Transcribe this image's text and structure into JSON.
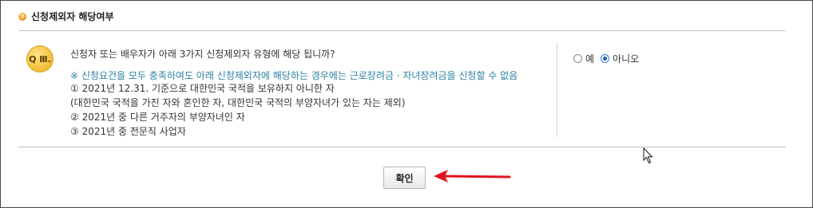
{
  "section": {
    "title": "신청제외자 해당여부"
  },
  "question": {
    "badge": "Q Ⅲ.",
    "text": "신청자 또는 배우자가 아래 3가지 신청제외자 유형에 해당 됩니까?",
    "note": "※ 신청요건을 모두 충족하여도 아래 신청제외자에 해당하는 경우에는 근로장려금 · 자녀장려금을 신청할 수 없음",
    "criteria": [
      "① 2021년 12.31. 기준으로 대한민국 국적을 보유하지 아니한 자",
      "(대한민국 국적을 가진 자와 혼인한 자, 대한민국 국적의 부양자녀가 있는 자는 제외)",
      "② 2021년 중 다른 거주자의 부양자녀인 자",
      "③ 2021년 중 전문직 사업자"
    ]
  },
  "options": [
    {
      "label": "예",
      "selected": false
    },
    {
      "label": "아니오",
      "selected": true
    }
  ],
  "actions": {
    "confirm_label": "확인"
  },
  "colors": {
    "note_text": "#2a7fa1",
    "annotation_arrow": "#e0141e",
    "badge": "#f5c242",
    "bullet": "#f3a021"
  }
}
